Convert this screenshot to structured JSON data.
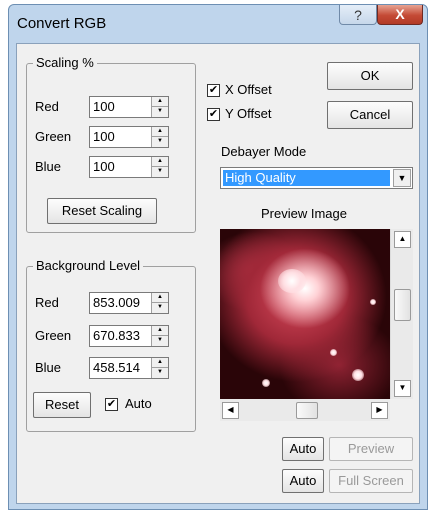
{
  "window": {
    "title": "Convert RGB",
    "help_label": "?",
    "close_label": "X"
  },
  "scaling": {
    "group_label": "Scaling %",
    "red_label": "Red",
    "red_value": "100",
    "green_label": "Green",
    "green_value": "100",
    "blue_label": "Blue",
    "blue_value": "100",
    "reset_label": "Reset Scaling"
  },
  "offsets": {
    "x_label": "X Offset",
    "x_checked": true,
    "y_label": "Y Offset",
    "y_checked": true
  },
  "buttons": {
    "ok_label": "OK",
    "cancel_label": "Cancel"
  },
  "debayer": {
    "label": "Debayer Mode",
    "selected": "High Quality"
  },
  "preview": {
    "label": "Preview Image",
    "auto1_label": "Auto",
    "preview_label": "Preview",
    "auto2_label": "Auto",
    "fullscreen_label": "Full Screen"
  },
  "background": {
    "group_label": "Background Level",
    "red_label": "Red",
    "red_value": "853.009",
    "green_label": "Green",
    "green_value": "670.833",
    "blue_label": "Blue",
    "blue_value": "458.514",
    "reset_label": "Reset",
    "auto_label": "Auto",
    "auto_checked": true
  },
  "icons": {
    "check": "✔",
    "arrow_up": "▲",
    "arrow_down": "▼",
    "arrow_left": "◀",
    "arrow_right": "▶"
  },
  "colors": {
    "title_bar": "#bfd5ec",
    "close": "#c44a35",
    "selection": "#3399ff"
  }
}
